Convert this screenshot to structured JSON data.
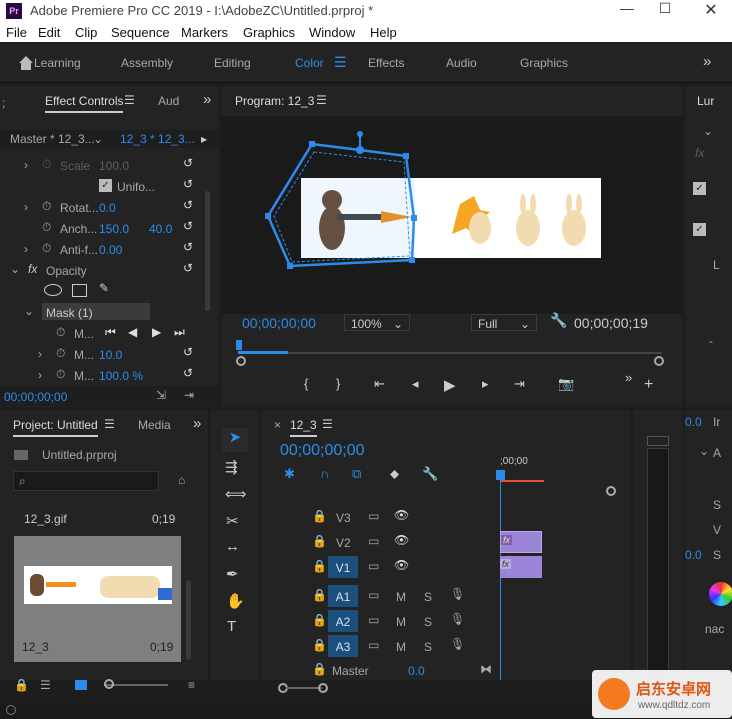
{
  "app": {
    "logo": "Pr",
    "title": "Adobe Premiere Pro CC 2019 - I:\\AdobeZC\\Untitled.prproj *"
  },
  "menu": [
    "File",
    "Edit",
    "Clip",
    "Sequence",
    "Markers",
    "Graphics",
    "Window",
    "Help"
  ],
  "workspaces": [
    "Learning",
    "Assembly",
    "Editing",
    "Color",
    "Effects",
    "Audio",
    "Graphics"
  ],
  "workspace_active": "Color",
  "effect_controls": {
    "tab": "Effect Controls",
    "tab2": "Aud",
    "master": "Master * 12_3...",
    "clip": "12_3 * 12_3...",
    "rows": {
      "scale": {
        "label": "Scale",
        "value": "100.0"
      },
      "uniform": {
        "label": "Unifo..."
      },
      "rotation": {
        "label": "Rotat...",
        "value": "0.0"
      },
      "anchor": {
        "label": "Anch...",
        "x": "150.0",
        "y": "40.0"
      },
      "antiflicker": {
        "label": "Anti-f...",
        "value": "0.00"
      },
      "opacity": {
        "label": "Opacity"
      },
      "mask": {
        "label": "Mask (1)"
      },
      "m1": {
        "label": "M..."
      },
      "m2": {
        "label": "M...",
        "value": "10.0"
      },
      "m3": {
        "label": "M...",
        "value": "100.0 %"
      }
    },
    "timecode": "00;00;00;00"
  },
  "program": {
    "title": "Program: 12_3",
    "timecode_left": "00;00;00;00",
    "zoom": "100%",
    "quality": "Full",
    "timecode_right": "00;00;00;19"
  },
  "right_panel": {
    "tab": "Lur",
    "labels": [
      "L",
      "I",
      "Ir",
      "A",
      "S",
      "S",
      "V",
      "S"
    ],
    "values": [
      "0.0",
      "0.0"
    ],
    "text": "nac"
  },
  "project": {
    "tab": "Project: Untitled",
    "tab2": "Media",
    "file": "Untitled.prproj",
    "item_name": "12_3.gif",
    "item_dur": "0;19",
    "seq_name": "12_3",
    "seq_dur": "0;19"
  },
  "timeline": {
    "tab": "12_3",
    "timecode": "00;00;00;00",
    "ruler": ";00;00",
    "tracks": [
      {
        "name": "V3",
        "type": "video"
      },
      {
        "name": "V2",
        "type": "video"
      },
      {
        "name": "V1",
        "type": "video"
      },
      {
        "name": "A1",
        "type": "audio"
      },
      {
        "name": "A2",
        "type": "audio"
      },
      {
        "name": "A3",
        "type": "audio"
      }
    ],
    "master": {
      "label": "Master",
      "value": "0.0"
    },
    "audio_mute": "M",
    "audio_solo": "S"
  },
  "watermark": {
    "cn": "启东安卓网",
    "url": "www.qdltdz.com"
  },
  "colors": {
    "accent": "#2d8ceb",
    "clip": "#9c85d6",
    "panel": "#232323",
    "bg": "#1d1d1d"
  }
}
